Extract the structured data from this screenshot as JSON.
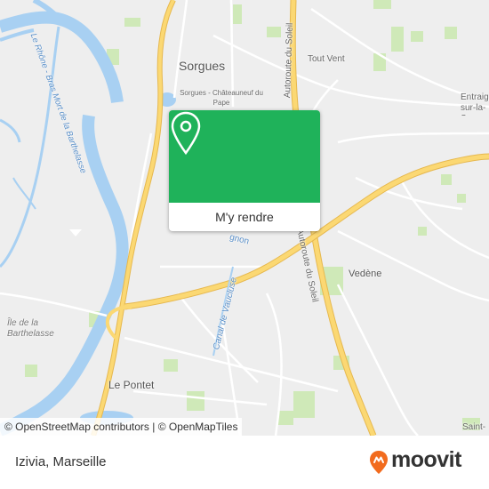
{
  "map": {
    "labels": {
      "sorgues": "Sorgues",
      "sorgues_station": "Sorgues - Châteauneuf du Pape",
      "tout_vent": "Tout Vent",
      "entraigues": "Entraig sur-la-S",
      "vedene": "Vedène",
      "le_pontet": "Le Pontet",
      "saint": "Saint-",
      "ile_barthelasse": "Île de la Barthelasse",
      "rhone": "Le Rhône - Bras Mort de la Barthelasse",
      "autoroute_top": "Autoroute du Soleil",
      "autoroute_bottom": "Autoroute du Soleil",
      "canal": "Canal de Vaucluse",
      "avignon_partial": "gnon"
    },
    "colors": {
      "land": "#eeeeee",
      "water": "#a3ccf0",
      "green": "#c9e7b0",
      "highway": "#fbd873",
      "highway_edge": "#e6b84f",
      "road": "#ffffff"
    }
  },
  "popup": {
    "button_label": "M'y rendre",
    "color": "#1fb25a"
  },
  "attribution": {
    "text": "© OpenStreetMap contributors | © OpenMapTiles"
  },
  "footer": {
    "title": "Izivia, Marseille",
    "logo_text": "moovit",
    "logo_color": "#f26b1d"
  }
}
